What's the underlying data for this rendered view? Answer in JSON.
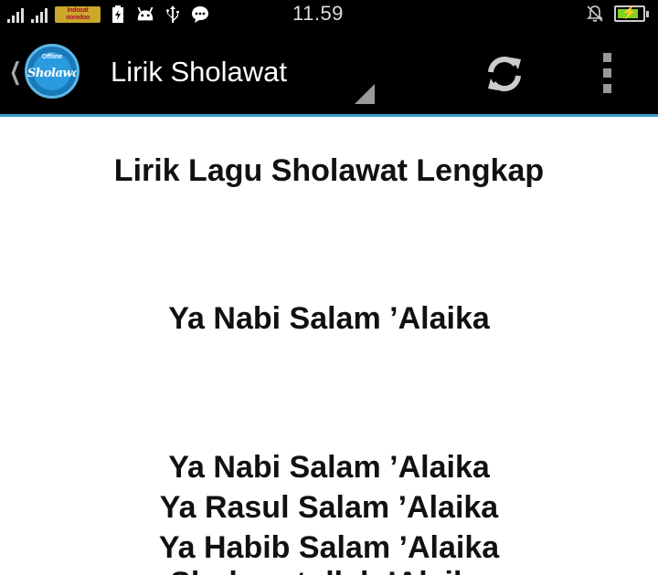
{
  "status_bar": {
    "signal_1_label": "1",
    "signal_2_label": "2",
    "carrier_text_top": "Indosat",
    "carrier_text_bottom": "ooredoo",
    "time": "11.59",
    "icons": [
      "signal-icon",
      "carrier-logo",
      "battery-saver-icon",
      "android-icon",
      "usb-icon",
      "chat-icon",
      "bell-off-icon",
      "battery-charging-icon"
    ],
    "battery_level": 0.85,
    "battery_color": "#7ed321"
  },
  "action_bar": {
    "back_icon": "back-chevron-icon",
    "logo_text_small": "Offline",
    "logo_text_big": "Sholawat",
    "title": "Lirik Sholawat",
    "refresh_icon": "refresh-icon",
    "overflow_icon": "overflow-menu-icon",
    "accent_color": "#33a0cc"
  },
  "content": {
    "heading": "Lirik Lagu Sholawat Lengkap",
    "song_title": "Ya Nabi Salam ’Alaika",
    "lyrics": [
      "Ya Nabi Salam ’Alaika",
      "Ya Rasul Salam ’Alaika",
      "Ya Habib Salam ’Alaika"
    ],
    "next_line_partial": "Sholawatullah ’Alaika"
  }
}
